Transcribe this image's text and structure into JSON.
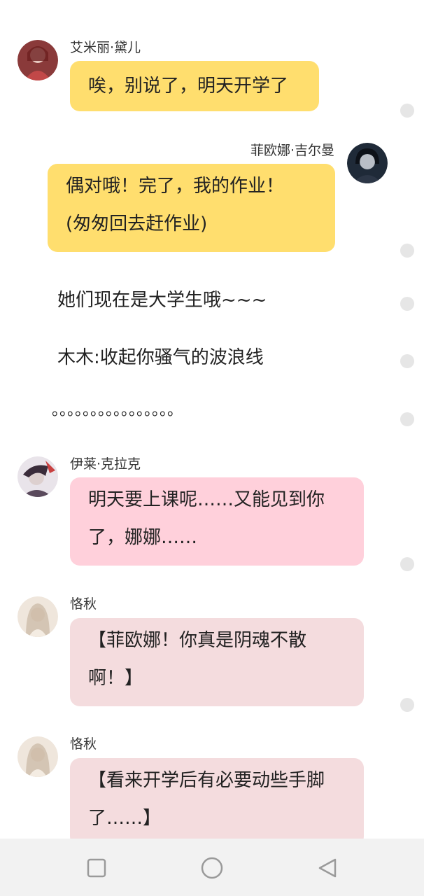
{
  "messages": [
    {
      "name": "艾米丽·黛儿",
      "lines": [
        "唉，别说了，明天开学了"
      ]
    },
    {
      "name": "菲欧娜·吉尔曼",
      "lines": [
        "偶对哦！完了，我的作业！",
        "(匆匆回去赶作业)"
      ]
    },
    {
      "name": "伊莱·克拉克",
      "lines": [
        "明天要上课呢……又能见到你",
        "了，娜娜……"
      ]
    },
    {
      "name": "恪秋",
      "lines": [
        "【菲欧娜！你真是阴魂不散",
        "啊！】"
      ]
    },
    {
      "name": "恪秋",
      "lines": [
        "【看来开学后有必要动些手脚",
        "了……】"
      ]
    }
  ],
  "narration": [
    "她们现在是大学生哦~~~",
    "木木:收起你骚气的波浪线",
    "。。。。。。。。。。。。。。。。"
  ],
  "colors": {
    "yellow_bubble": "#ffde6e",
    "pink_bubble": "#ffd0db",
    "rose_bubble": "#f4dcde",
    "nav_bar": "#f2f2f2"
  },
  "nav_icons": [
    "square-icon",
    "circle-icon",
    "triangle-back-icon"
  ]
}
